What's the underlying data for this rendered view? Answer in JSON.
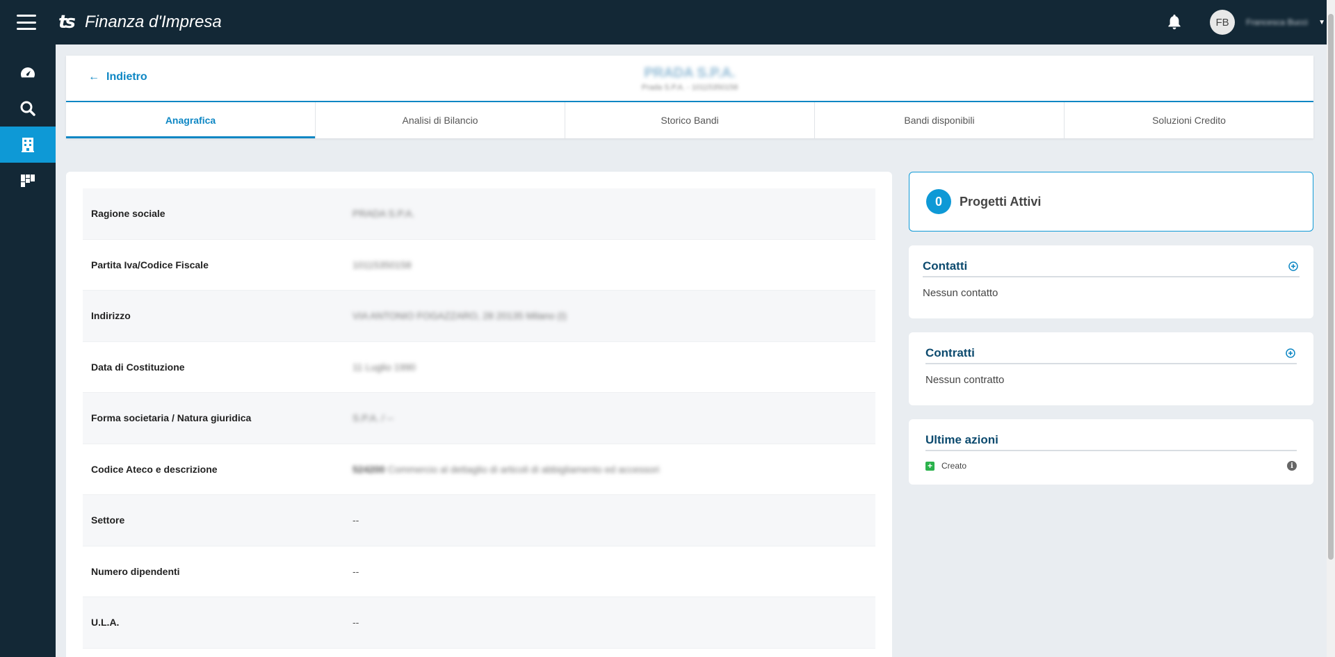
{
  "app": {
    "brand": "Finanza d'Impresa",
    "logo_text": "ts",
    "user_initials": "FB",
    "user_name": "Francesca Bucci"
  },
  "sidebar": {
    "items": [
      {
        "name": "dashboard",
        "icon": "speedometer-icon",
        "active": false
      },
      {
        "name": "search",
        "icon": "search-icon",
        "active": false
      },
      {
        "name": "companies",
        "icon": "building-icon",
        "active": true
      },
      {
        "name": "boards",
        "icon": "dashboard-tiles-icon",
        "active": false
      }
    ]
  },
  "header": {
    "back_label": "Indietro",
    "company_name": "PRADA S.P.A.",
    "company_sub": "Prada S.P.A. - 10115350158"
  },
  "tabs": [
    {
      "label": "Anagrafica",
      "active": true
    },
    {
      "label": "Analisi di Bilancio",
      "active": false
    },
    {
      "label": "Storico Bandi",
      "active": false
    },
    {
      "label": "Bandi disponibili",
      "active": false
    },
    {
      "label": "Soluzioni Credito",
      "active": false
    }
  ],
  "info": {
    "rows": [
      {
        "label": "Ragione sociale",
        "value": "PRADA S.P.A."
      },
      {
        "label": "Partita Iva/Codice Fiscale",
        "value": "10115350158"
      },
      {
        "label": "Indirizzo",
        "value": "VIA ANTONIO FOGAZZARO, 28 20135 Milano (I)"
      },
      {
        "label": "Data di Costituzione",
        "value": "11 Luglio 1990"
      },
      {
        "label": "Forma societaria / Natura giuridica",
        "value": "S.P.A. / --"
      },
      {
        "label": "Codice Ateco e descrizione",
        "code": "524200",
        "value": "Commercio al dettaglio di articoli di abbigliamento ed accessori"
      },
      {
        "label": "Settore",
        "value": "--"
      },
      {
        "label": "Numero dipendenti",
        "value": "--"
      },
      {
        "label": "U.L.A.",
        "value": "--"
      }
    ]
  },
  "right": {
    "progetti": {
      "count": "0",
      "title": "Progetti Attivi"
    },
    "contatti": {
      "title": "Contatti",
      "empty": "Nessun contatto"
    },
    "contratti": {
      "title": "Contratti",
      "empty": "Nessun contratto"
    },
    "azioni": {
      "title": "Ultime azioni",
      "items": [
        {
          "label": "Creato"
        }
      ]
    }
  },
  "colors": {
    "dark": "#132836",
    "accent": "#0e99d6",
    "link": "#0e87c4",
    "panel_title": "#0c4a6e"
  }
}
